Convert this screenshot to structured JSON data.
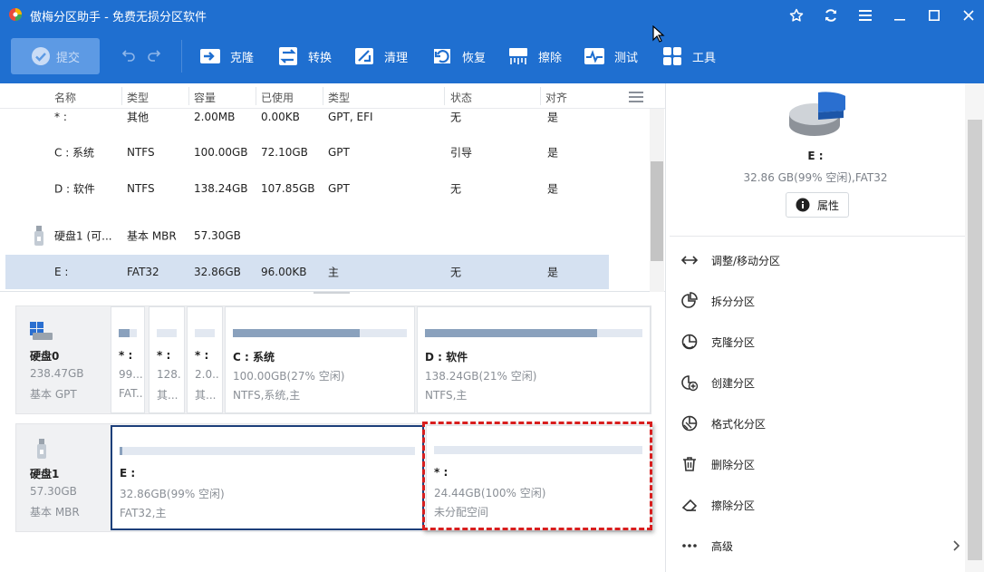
{
  "window": {
    "title": "傲梅分区助手 - 免费无损分区软件"
  },
  "toolbar": {
    "submit_label": "提交",
    "tools": [
      {
        "label": "克隆",
        "icon": "clone-icon"
      },
      {
        "label": "转换",
        "icon": "convert-icon"
      },
      {
        "label": "清理",
        "icon": "clean-icon"
      },
      {
        "label": "恢复",
        "icon": "recover-icon"
      },
      {
        "label": "擦除",
        "icon": "wipe-icon"
      },
      {
        "label": "测试",
        "icon": "test-icon"
      },
      {
        "label": "工具",
        "icon": "tools-icon"
      }
    ]
  },
  "list": {
    "headers": [
      "名称",
      "类型",
      "容量",
      "已使用",
      "类型",
      "状态",
      "对齐"
    ],
    "rows": [
      {
        "name": "* :",
        "type": "其他",
        "capacity": "2.00MB",
        "used": "0.00KB",
        "ptype": "GPT, EFI",
        "status": "无",
        "align": "是"
      },
      {
        "name": "C : 系统",
        "type": "NTFS",
        "capacity": "100.00GB",
        "used": "72.10GB",
        "ptype": "GPT",
        "status": "引导",
        "align": "是"
      },
      {
        "name": "D : 软件",
        "type": "NTFS",
        "capacity": "138.24GB",
        "used": "107.85GB",
        "ptype": "GPT",
        "status": "无",
        "align": "是"
      },
      {
        "name": "硬盘1 (可...",
        "type": "基本 MBR",
        "capacity": "57.30GB",
        "used": "",
        "ptype": "",
        "status": "",
        "align": ""
      },
      {
        "name": "E :",
        "type": "FAT32",
        "capacity": "32.86GB",
        "used": "96.00KB",
        "ptype": "主",
        "status": "无",
        "align": "是"
      }
    ]
  },
  "disks": [
    {
      "name": "硬盘0",
      "size": "238.47GB",
      "style": "基本 GPT",
      "partitions": [
        {
          "name": "* :",
          "line2": "99....",
          "line3": "FAT...",
          "used_fraction": 0.6
        },
        {
          "name": "* :",
          "line2": "128....",
          "line3": "其...",
          "used_fraction": 0
        },
        {
          "name": "* :",
          "line2": "2.0...",
          "line3": "其...",
          "used_fraction": 0
        },
        {
          "name": "C : 系统",
          "line2": "100.00GB(27% 空闲)",
          "line3": "NTFS,系统,主",
          "used_fraction": 0.73
        },
        {
          "name": "D : 软件",
          "line2": "138.24GB(21% 空闲)",
          "line3": "NTFS,主",
          "used_fraction": 0.79
        }
      ]
    },
    {
      "name": "硬盘1",
      "size": "57.30GB",
      "style": "基本 MBR",
      "partitions": [
        {
          "name": "E :",
          "line2": "32.86GB(99% 空闲)",
          "line3": "FAT32,主",
          "used_fraction": 0.01
        },
        {
          "name": "* :",
          "line2": "24.44GB(100% 空闲)",
          "line3": "未分配空间",
          "used_fraction": 0
        }
      ]
    }
  ],
  "side": {
    "selected_name": "E :",
    "selected_info": "32.86 GB(99% 空闲),FAT32",
    "properties_label": "属性",
    "operations": [
      {
        "label": "调整/移动分区",
        "icon": "resize-move-icon"
      },
      {
        "label": "拆分分区",
        "icon": "split-partition-icon"
      },
      {
        "label": "克隆分区",
        "icon": "clone-partition-icon"
      },
      {
        "label": "创建分区",
        "icon": "create-partition-icon"
      },
      {
        "label": "格式化分区",
        "icon": "format-partition-icon"
      },
      {
        "label": "删除分区",
        "icon": "delete-partition-icon"
      },
      {
        "label": "擦除分区",
        "icon": "wipe-partition-icon"
      },
      {
        "label": "高级",
        "icon": "more-icon"
      }
    ]
  },
  "colors": {
    "accent": "#1f6fd0",
    "selection": "#d5e1f1",
    "highlight": "#d81e1e",
    "bar_fill": "#8aa1bd"
  }
}
